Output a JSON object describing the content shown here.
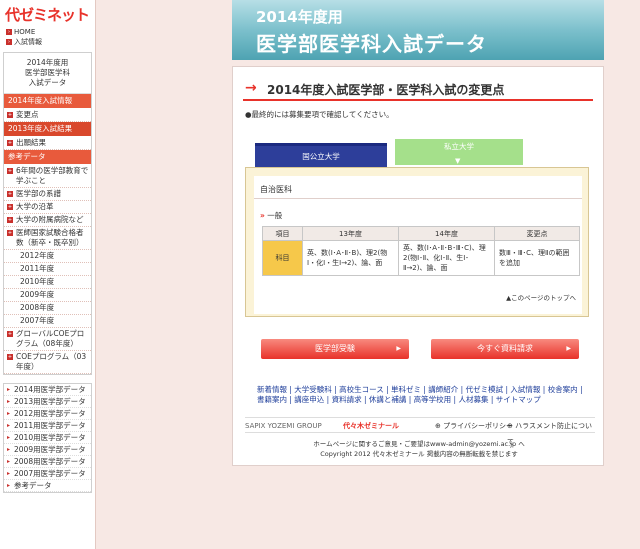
{
  "sidebar": {
    "logo": "代ゼミネット",
    "home": "HOME",
    "nyushi": "入試情報",
    "box_title_1": "2014年度用",
    "box_title_2": "医学部医学科",
    "box_title_3": "入試データ",
    "sec1": "2014年度入試情報",
    "sec1_items": [
      "変更点"
    ],
    "sec2": "2013年度入試結果",
    "sec2_items": [
      "出願結果"
    ],
    "sec3": "参考データ",
    "sec3_items": [
      "6年間の医学部教育で学ぶこと",
      "医学部の系譜",
      "大学の沿革",
      "大学の附属病院など",
      "医師国家試験合格者数（新卒・既卒別）"
    ],
    "years": [
      "2012年度",
      "2011年度",
      "2010年度",
      "2009年度",
      "2008年度",
      "2007年度"
    ],
    "coe_items": [
      "グローバルCOEプログラム（08年度）",
      "COEプログラム（03年度）"
    ],
    "lower": [
      "2014用医学部データ",
      "2013用医学部データ",
      "2012用医学部データ",
      "2011用医学部データ",
      "2010用医学部データ",
      "2009用医学部データ",
      "2008用医学部データ",
      "2007用医学部データ",
      "参考データ"
    ]
  },
  "banner": {
    "line1": "2014年度用",
    "line2": "医学部医学科入試データ"
  },
  "main": {
    "title": "2014年度入試医学部・医学科入試の変更点",
    "note": "●最終的には募集要項で確認してください。",
    "tab_public": "国公立大学",
    "tab_private": "私立大学",
    "univ": "自治医科",
    "section": "一般",
    "table": {
      "headers": [
        "項目",
        "13年度",
        "14年度",
        "変更点"
      ],
      "row": {
        "subject": "科目",
        "y13": "英、数(Ⅰ･A･Ⅱ･B)、理2(物Ⅰ・化Ⅰ・生Ⅰ→2)、論、面",
        "y14": "英、数(Ⅰ･A･Ⅱ･B･Ⅲ･C)、理2(物Ⅰ･Ⅱ、化Ⅰ･Ⅱ、生Ⅰ･Ⅱ→2)、論、面",
        "change": "数Ⅲ・Ⅲ･C、理Ⅱの範囲を追加"
      }
    },
    "to_top": "▲このページのトップへ",
    "btn_exam": "医学部受験",
    "btn_request": "今すぐ資料請求",
    "links": "新着情報 | 大学受験科 | 高校生コース | 単科ゼミ | 講師紹介 | 代ゼミ模試 | 入試情報 | 校舎案内 | 書籍案内 | 講座申込 | 資料請求 | 休講と補講 | 高等学校用 | 人材募集 | サイトマップ",
    "group": "SAPIX YOZEMI GROUP",
    "yzm": "代々木ゼミナール",
    "privacy": "プライバシーポリシー",
    "harassment": "ハラスメント防止について",
    "contact1": "ホームページに関するご意見・ご要望はwww-admin@yozemi.ac.jp へ",
    "contact2": "Copyright 2012 代々木ゼミナール 掲載内容の無断転載を禁じます"
  }
}
